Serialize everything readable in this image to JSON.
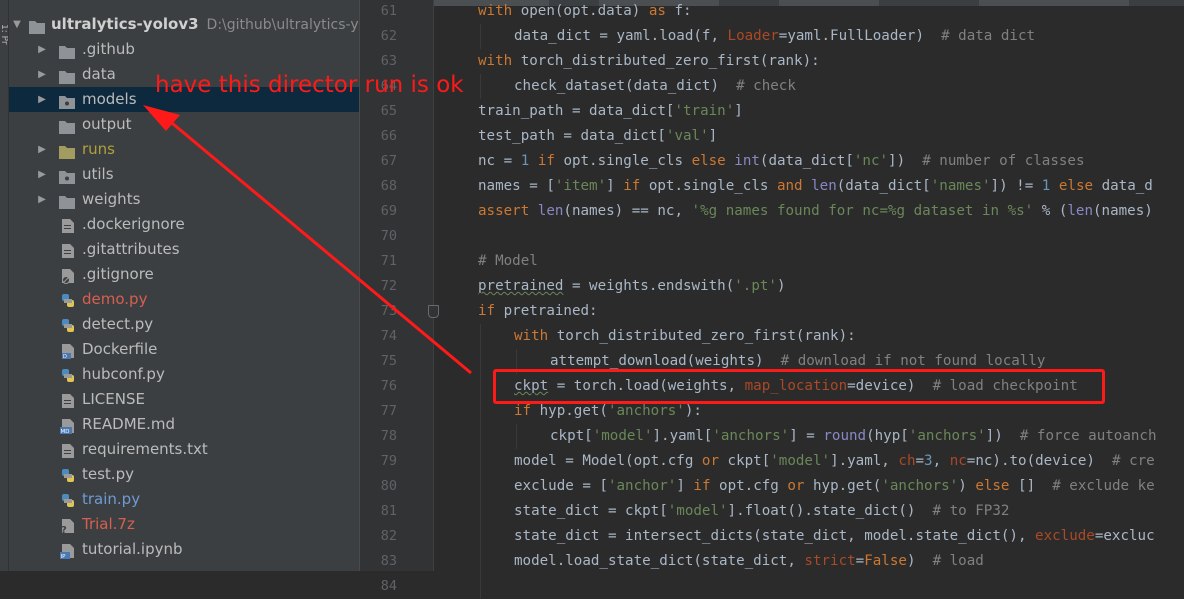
{
  "annotation": {
    "note": "have this director run is ok",
    "color": "#ff1a1a"
  },
  "toolstrip": {
    "label": "1: Pr"
  },
  "project_tree": {
    "root": {
      "name": "ultralytics-yolov3",
      "path": "D:\\github\\ultralytics-yo"
    },
    "items": [
      {
        "label": "github",
        "display": ".github",
        "kind": "folder",
        "expandable": true
      },
      {
        "label": "data",
        "display": "data",
        "kind": "folder",
        "expandable": true
      },
      {
        "label": "models",
        "display": "models",
        "kind": "package-folder",
        "expandable": true,
        "selected": true
      },
      {
        "label": "output",
        "display": "output",
        "kind": "folder",
        "expandable": false
      },
      {
        "label": "runs",
        "display": "runs",
        "kind": "folder-excluded",
        "expandable": true,
        "color": "#b0a23a"
      },
      {
        "label": "utils",
        "display": "utils",
        "kind": "package-folder",
        "expandable": true
      },
      {
        "label": "weights",
        "display": "weights",
        "kind": "folder",
        "expandable": true
      },
      {
        "label": "dockerignore",
        "display": ".dockerignore",
        "kind": "text-file"
      },
      {
        "label": "gitattributes",
        "display": ".gitattributes",
        "kind": "text-file"
      },
      {
        "label": "gitignore",
        "display": ".gitignore",
        "kind": "ignore-file"
      },
      {
        "label": "demo-py",
        "display": "demo.py",
        "kind": "python-file",
        "color": "#d65f4f"
      },
      {
        "label": "detect-py",
        "display": "detect.py",
        "kind": "python-file"
      },
      {
        "label": "dockerfile",
        "display": "Dockerfile",
        "kind": "docker-file"
      },
      {
        "label": "hubconf-py",
        "display": "hubconf.py",
        "kind": "python-file"
      },
      {
        "label": "license",
        "display": "LICENSE",
        "kind": "text-file"
      },
      {
        "label": "readme-md",
        "display": "README.md",
        "kind": "markdown-file"
      },
      {
        "label": "requirements-txt",
        "display": "requirements.txt",
        "kind": "text-file"
      },
      {
        "label": "test-py",
        "display": "test.py",
        "kind": "python-file"
      },
      {
        "label": "train-py",
        "display": "train.py",
        "kind": "python-file",
        "color": "#6e9bd4"
      },
      {
        "label": "trial-7z",
        "display": "Trial.7z",
        "kind": "unknown-file",
        "color": "#d65f4f"
      },
      {
        "label": "tutorial-ipynb",
        "display": "tutorial.ipynb",
        "kind": "notebook-file"
      }
    ]
  },
  "editor": {
    "line_numbers": [
      "61",
      "62",
      "63",
      "64",
      "65",
      "66",
      "67",
      "68",
      "69",
      "70",
      "71",
      "72",
      "73",
      "74",
      "75",
      "76",
      "77",
      "78",
      "79",
      "80",
      "81",
      "82",
      "83",
      "84"
    ],
    "lines": [
      {
        "indent": 0,
        "tokens": [
          [
            "kw",
            "with "
          ],
          [
            "",
            "open(opt.data) "
          ],
          [
            "kw",
            "as "
          ],
          [
            "",
            "f:"
          ]
        ]
      },
      {
        "indent": 1,
        "tokens": [
          [
            "",
            "data_dict = yaml.load(f, "
          ],
          [
            "prm",
            "Loader"
          ],
          [
            "",
            "=yaml.FullLoader)  "
          ],
          [
            "cm",
            "# data dict"
          ]
        ]
      },
      {
        "indent": 0,
        "tokens": [
          [
            "kw",
            "with "
          ],
          [
            "",
            "torch_distributed_zero_first(rank):"
          ]
        ]
      },
      {
        "indent": 1,
        "tokens": [
          [
            "",
            "check_dataset(data_dict)  "
          ],
          [
            "cm",
            "# check"
          ]
        ]
      },
      {
        "indent": 0,
        "tokens": [
          [
            "",
            "train_path = data_dict["
          ],
          [
            "str",
            "'train'"
          ],
          [
            "",
            "]"
          ]
        ]
      },
      {
        "indent": 0,
        "tokens": [
          [
            "",
            "test_path = data_dict["
          ],
          [
            "str",
            "'val'"
          ],
          [
            "",
            "]"
          ]
        ]
      },
      {
        "indent": 0,
        "tokens": [
          [
            "",
            "nc = "
          ],
          [
            "num",
            "1 "
          ],
          [
            "kw",
            "if "
          ],
          [
            "",
            "opt.single_cls "
          ],
          [
            "kw",
            "else "
          ],
          [
            "fn",
            "int"
          ],
          [
            "",
            "(data_dict["
          ],
          [
            "str",
            "'nc'"
          ],
          [
            "",
            "])  "
          ],
          [
            "cm",
            "# number of classes"
          ]
        ]
      },
      {
        "indent": 0,
        "tokens": [
          [
            "",
            "names = ["
          ],
          [
            "str",
            "'item'"
          ],
          [
            "",
            "] "
          ],
          [
            "kw",
            "if "
          ],
          [
            "",
            "opt.single_cls "
          ],
          [
            "kw",
            "and "
          ],
          [
            "fn",
            "len"
          ],
          [
            "",
            "(data_dict["
          ],
          [
            "str",
            "'names'"
          ],
          [
            "",
            "]) != "
          ],
          [
            "num",
            "1 "
          ],
          [
            "kw",
            "else "
          ],
          [
            "",
            "data_d"
          ]
        ]
      },
      {
        "indent": 0,
        "tokens": [
          [
            "kw",
            "assert "
          ],
          [
            "fn",
            "len"
          ],
          [
            "",
            "(names) == nc, "
          ],
          [
            "str",
            "'%g names found for nc=%g dataset in %s'"
          ],
          [
            "",
            " % ("
          ],
          [
            "fn",
            "len"
          ],
          [
            "",
            "(names)"
          ]
        ]
      },
      {
        "indent": 0,
        "tokens": []
      },
      {
        "indent": 0,
        "tokens": [
          [
            "cm",
            "# Model"
          ]
        ]
      },
      {
        "indent": 0,
        "tokens": [
          [
            "sq",
            "pretrained"
          ],
          [
            "",
            " = weights.endswith("
          ],
          [
            "str",
            "'.pt'"
          ],
          [
            "",
            ")"
          ]
        ]
      },
      {
        "indent": 0,
        "tokens": [
          [
            "kw",
            "if "
          ],
          [
            "",
            "pretrained:"
          ]
        ]
      },
      {
        "indent": 1,
        "tokens": [
          [
            "kw",
            "with "
          ],
          [
            "",
            "torch_distributed_zero_first(rank):"
          ]
        ]
      },
      {
        "indent": 2,
        "tokens": [
          [
            "",
            "attempt_download(weights)  "
          ],
          [
            "cm",
            "# download if not found locally"
          ]
        ]
      },
      {
        "indent": 1,
        "tokens": [
          [
            "sq",
            "ckpt"
          ],
          [
            "",
            " = torch.load(weights, "
          ],
          [
            "prm",
            "map_location"
          ],
          [
            "",
            "=device)  "
          ],
          [
            "cm",
            "# load checkpoint"
          ]
        ]
      },
      {
        "indent": 1,
        "tokens": [
          [
            "kw",
            "if "
          ],
          [
            "",
            "hyp.get("
          ],
          [
            "str",
            "'anchors'"
          ],
          [
            "",
            "):"
          ]
        ]
      },
      {
        "indent": 2,
        "tokens": [
          [
            "",
            "ckpt["
          ],
          [
            "str",
            "'model'"
          ],
          [
            "",
            "].yaml["
          ],
          [
            "str",
            "'anchors'"
          ],
          [
            "",
            "] = "
          ],
          [
            "fn",
            "round"
          ],
          [
            "",
            "(hyp["
          ],
          [
            "str",
            "'anchors'"
          ],
          [
            "",
            "])  "
          ],
          [
            "cm",
            "# force autoanch"
          ]
        ]
      },
      {
        "indent": 1,
        "tokens": [
          [
            "",
            "model = Model(opt.cfg "
          ],
          [
            "kw",
            "or "
          ],
          [
            "",
            "ckpt["
          ],
          [
            "str",
            "'model'"
          ],
          [
            "",
            "].yaml, "
          ],
          [
            "prm",
            "ch"
          ],
          [
            "",
            "="
          ],
          [
            "num",
            "3"
          ],
          [
            "",
            ", "
          ],
          [
            "prm",
            "nc"
          ],
          [
            "",
            "=nc).to(device)  "
          ],
          [
            "cm",
            "# cre"
          ]
        ]
      },
      {
        "indent": 1,
        "tokens": [
          [
            "",
            "exclude = ["
          ],
          [
            "str",
            "'anchor'"
          ],
          [
            "",
            "] "
          ],
          [
            "kw",
            "if "
          ],
          [
            "",
            "opt.cfg "
          ],
          [
            "kw",
            "or "
          ],
          [
            "",
            "hyp.get("
          ],
          [
            "str",
            "'anchors'"
          ],
          [
            "",
            ") "
          ],
          [
            "kw",
            "else "
          ],
          [
            "",
            "[]  "
          ],
          [
            "cm",
            "# exclude ke"
          ]
        ]
      },
      {
        "indent": 1,
        "tokens": [
          [
            "",
            "state_dict = ckpt["
          ],
          [
            "str",
            "'model'"
          ],
          [
            "",
            "].float().state_dict()  "
          ],
          [
            "cm",
            "# to FP32"
          ]
        ]
      },
      {
        "indent": 1,
        "tokens": [
          [
            "",
            "state_dict = intersect_dicts(state_dict, model.state_dict(), "
          ],
          [
            "prm",
            "exclude"
          ],
          [
            "",
            "=excluc"
          ]
        ]
      },
      {
        "indent": 1,
        "tokens": [
          [
            "",
            "model.load_state_dict(state_dict, "
          ],
          [
            "prm",
            "strict"
          ],
          [
            "",
            "="
          ],
          [
            "kw",
            "False"
          ],
          [
            "",
            ")  "
          ],
          [
            "cm",
            "# load"
          ]
        ]
      },
      {
        "indent": 1,
        "tokens": []
      }
    ]
  }
}
